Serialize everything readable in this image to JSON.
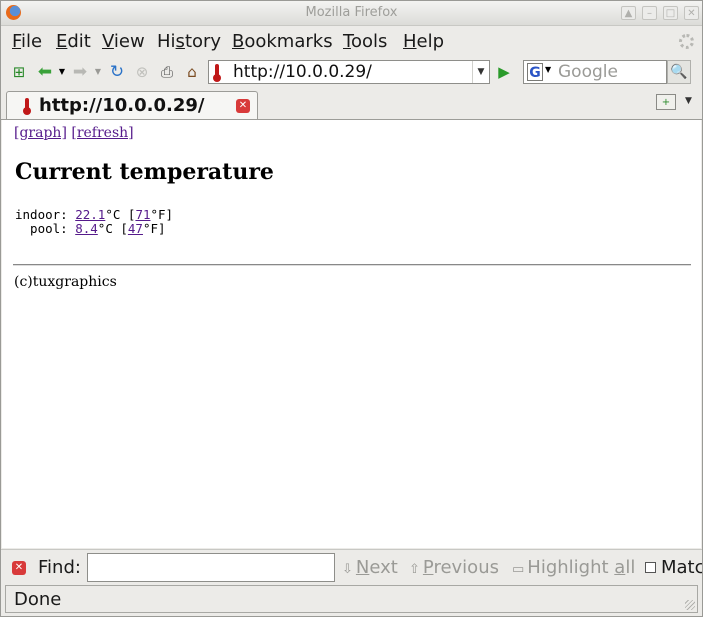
{
  "window": {
    "title": "Mozilla Firefox"
  },
  "menu": {
    "items": [
      {
        "pre": "",
        "u": "F",
        "post": "ile"
      },
      {
        "pre": "",
        "u": "E",
        "post": "dit"
      },
      {
        "pre": "",
        "u": "V",
        "post": "iew"
      },
      {
        "pre": "Hi",
        "u": "s",
        "post": "tory"
      },
      {
        "pre": "",
        "u": "B",
        "post": "ookmarks"
      },
      {
        "pre": "",
        "u": "T",
        "post": "ools"
      },
      {
        "pre": "",
        "u": "H",
        "post": "elp"
      }
    ]
  },
  "navbar": {
    "url": "http://10.0.0.29/",
    "search_placeholder": "Google",
    "search_engine_letter": "G"
  },
  "tabs": [
    {
      "label": "http://10.0.0.29/"
    }
  ],
  "page": {
    "links": {
      "graph": "[graph]",
      "refresh": "[refresh]"
    },
    "heading": "Current temperature",
    "readings": [
      {
        "label": "indoor: ",
        "celsius": "22.1",
        "fahrenheit": "71"
      },
      {
        "label": "  pool: ",
        "celsius": "8.4",
        "fahrenheit": "47"
      }
    ],
    "units": {
      "c_mid": "°C [",
      "f_end": "°F]"
    },
    "footer": "(c)tuxgraphics"
  },
  "findbar": {
    "label": "Find:",
    "value": "",
    "next_pre": "",
    "next_u": "N",
    "next_post": "ext",
    "prev_pre": "",
    "prev_u": "P",
    "prev_post": "revious",
    "highlight_pre": "Highlight ",
    "highlight_u": "a",
    "highlight_post": "ll",
    "match_text": "Matc"
  },
  "status": {
    "text": "Done"
  },
  "colors": {
    "link": "#551a8b",
    "accent_green": "#2a9a2a",
    "close_red": "#d83a3a"
  }
}
